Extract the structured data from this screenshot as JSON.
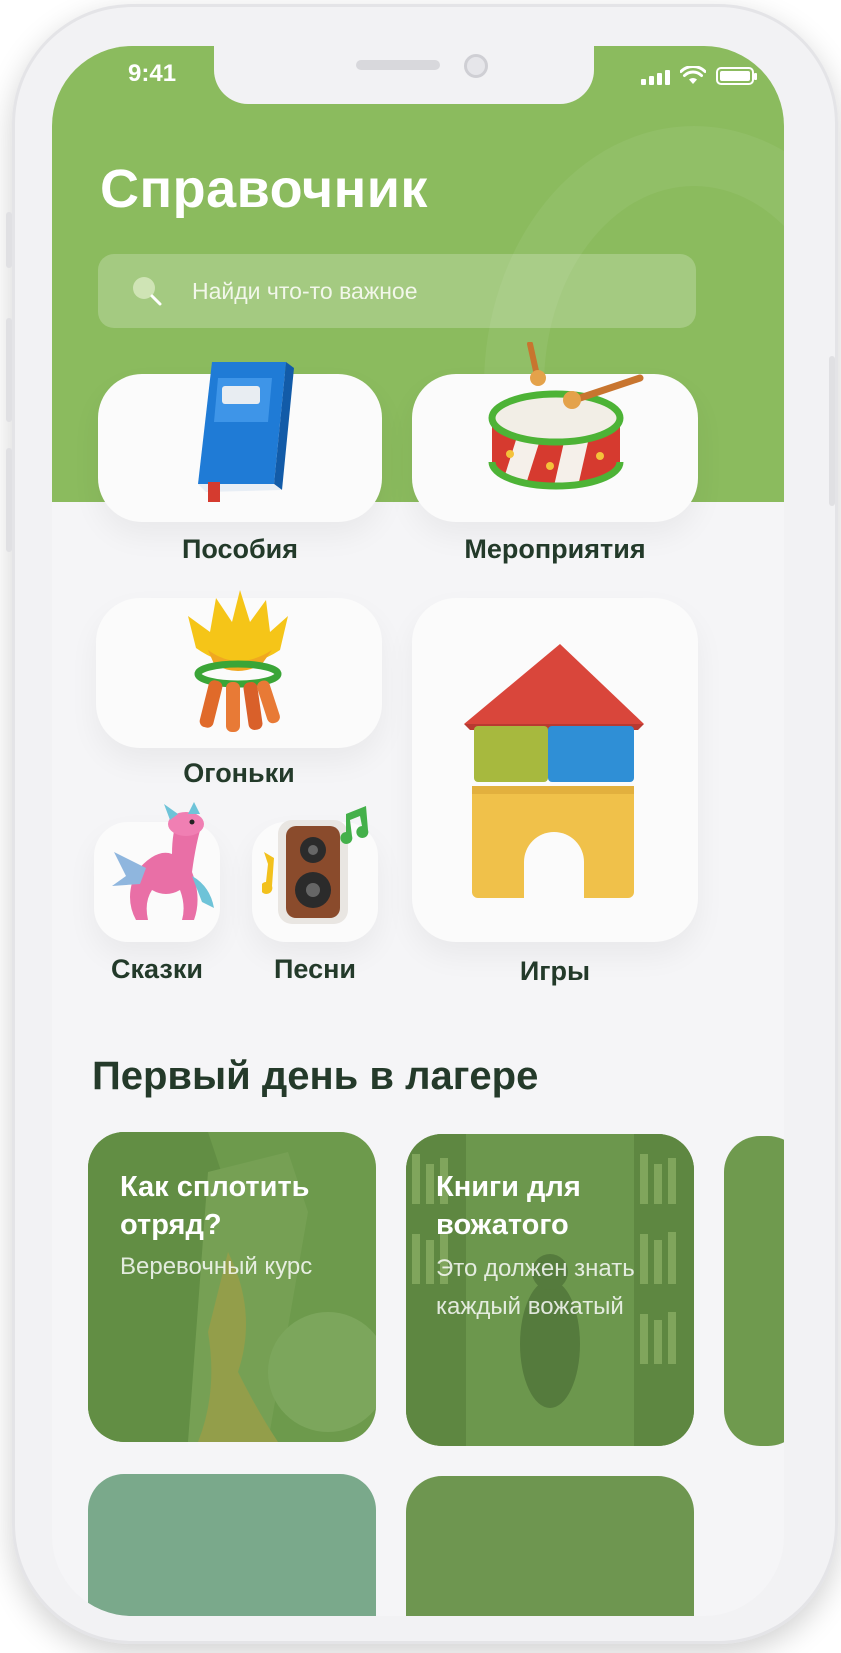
{
  "status": {
    "time": "9:41"
  },
  "header": {
    "title": "Справочник",
    "search_placeholder": "Найди что-то важное"
  },
  "categories": [
    {
      "label": "Пособия",
      "icon": "book-icon"
    },
    {
      "label": "Мероприятия",
      "icon": "drum-icon"
    },
    {
      "label": "Огоньки",
      "icon": "campfire-icon"
    },
    {
      "label": "Игры",
      "icon": "toy-house-blocks-icon"
    },
    {
      "label": "Сказки",
      "icon": "dragon-icon"
    },
    {
      "label": "Песни",
      "icon": "speaker-music-icon"
    }
  ],
  "section": {
    "title": "Первый день в лагере",
    "cards": [
      {
        "title": "Как сплотить отряд?",
        "subtitle": "Веревочный курс"
      },
      {
        "title": "Книги для вожатого",
        "subtitle": "Это должен знать каждый вожатый"
      }
    ]
  },
  "colors": {
    "header_green": "#8bbb5e",
    "card_overlay_green": "#6b9a4a",
    "label_text": "#233a2a",
    "background": "#f5f5f7"
  }
}
